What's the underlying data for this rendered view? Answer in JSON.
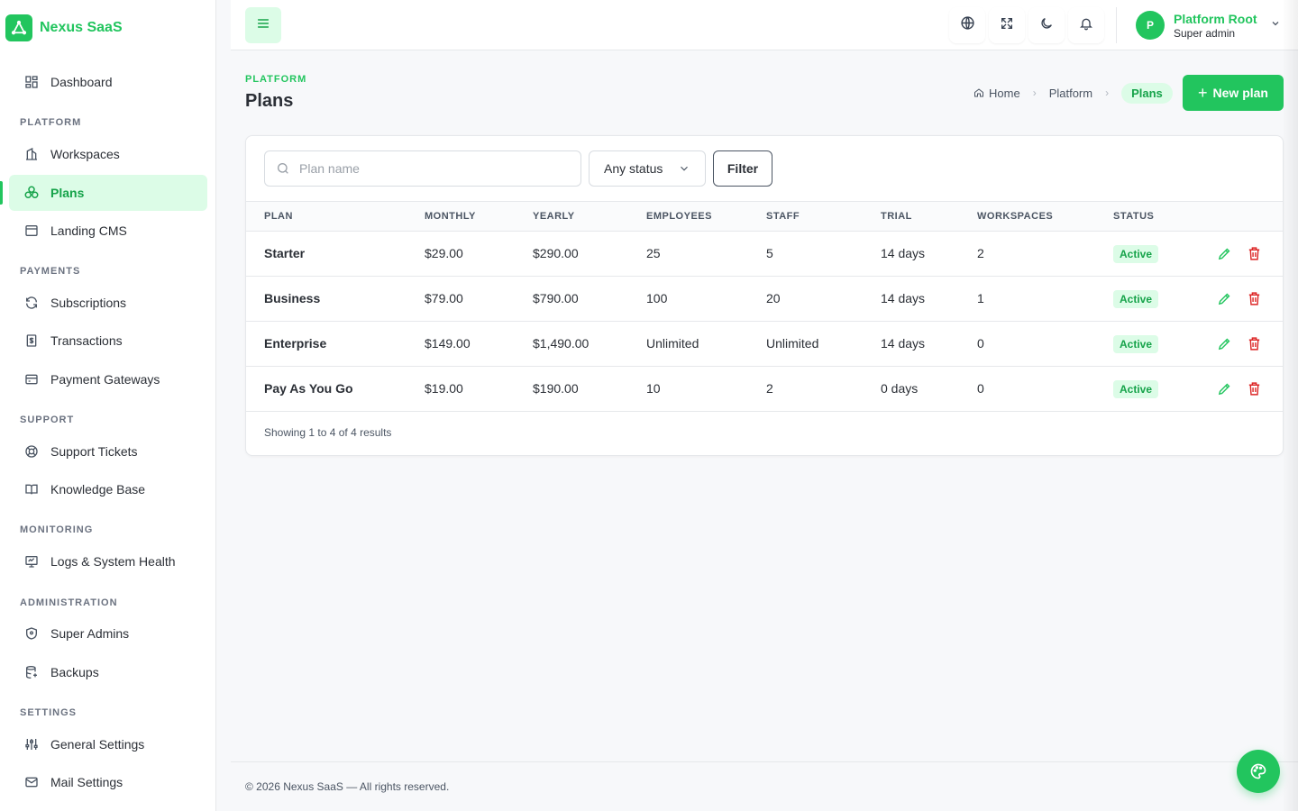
{
  "brand": {
    "name": "Nexus SaaS",
    "logo_icon": "logo-icon",
    "color": "#22c55e"
  },
  "sidebar": {
    "dashboard": {
      "label": "Dashboard",
      "icon": "dashboard-icon"
    },
    "sections": {
      "platform": "PLATFORM",
      "payments": "PAYMENTS",
      "support": "SUPPORT",
      "monitoring": "MONITORING",
      "administration": "ADMINISTRATION",
      "settings": "SETTINGS"
    },
    "items": {
      "workspaces": {
        "label": "Workspaces",
        "icon": "building-icon"
      },
      "plans": {
        "label": "Plans",
        "icon": "plans-icon",
        "active": true
      },
      "landing_cms": {
        "label": "Landing CMS",
        "icon": "browser-icon"
      },
      "subscriptions": {
        "label": "Subscriptions",
        "icon": "refresh-icon"
      },
      "transactions": {
        "label": "Transactions",
        "icon": "receipt-icon"
      },
      "payment_gateways": {
        "label": "Payment Gateways",
        "icon": "credit-card-icon"
      },
      "support_tickets": {
        "label": "Support Tickets",
        "icon": "lifebuoy-icon"
      },
      "knowledge_base": {
        "label": "Knowledge Base",
        "icon": "book-icon"
      },
      "logs": {
        "label": "Logs & System Health",
        "icon": "monitor-icon"
      },
      "super_admins": {
        "label": "Super Admins",
        "icon": "shield-icon"
      },
      "backups": {
        "label": "Backups",
        "icon": "database-icon"
      },
      "general_settings": {
        "label": "General Settings",
        "icon": "sliders-icon"
      },
      "mail_settings": {
        "label": "Mail Settings",
        "icon": "mail-icon"
      }
    }
  },
  "topbar": {
    "menu_icon": "hamburger-icon",
    "icons": [
      "globe-icon",
      "fullscreen-icon",
      "moon-icon",
      "bell-icon"
    ],
    "user": {
      "initial": "P",
      "name": "Platform Root",
      "role": "Super admin"
    }
  },
  "page": {
    "section": "PLATFORM",
    "title": "Plans",
    "breadcrumb": {
      "home": "Home",
      "platform": "Platform",
      "current": "Plans"
    },
    "new_button": "New plan"
  },
  "filters": {
    "search_placeholder": "Plan name",
    "search_value": "",
    "status_selected": "Any status",
    "filter_button": "Filter"
  },
  "table": {
    "headers": {
      "plan": "PLAN",
      "monthly": "MONTHLY",
      "yearly": "YEARLY",
      "employees": "EMPLOYEES",
      "staff": "STAFF",
      "trial": "TRIAL",
      "workspaces": "WORKSPACES",
      "status": "STATUS"
    },
    "rows": [
      {
        "plan": "Starter",
        "monthly": "$29.00",
        "yearly": "$290.00",
        "employees": "25",
        "staff": "5",
        "trial": "14 days",
        "workspaces": "2",
        "status": "Active"
      },
      {
        "plan": "Business",
        "monthly": "$79.00",
        "yearly": "$790.00",
        "employees": "100",
        "staff": "20",
        "trial": "14 days",
        "workspaces": "1",
        "status": "Active"
      },
      {
        "plan": "Enterprise",
        "monthly": "$149.00",
        "yearly": "$1,490.00",
        "employees": "Unlimited",
        "staff": "Unlimited",
        "trial": "14 days",
        "workspaces": "0",
        "status": "Active"
      },
      {
        "plan": "Pay As You Go",
        "monthly": "$19.00",
        "yearly": "$190.00",
        "employees": "10",
        "staff": "2",
        "trial": "0 days",
        "workspaces": "0",
        "status": "Active"
      }
    ],
    "summary": "Showing 1 to 4 of 4 results"
  },
  "footer": {
    "copyright": "© 2026 Nexus SaaS — All rights reserved."
  },
  "colors": {
    "accent": "#22c55e",
    "accent_light": "#dcfce7",
    "danger": "#dc2626"
  }
}
